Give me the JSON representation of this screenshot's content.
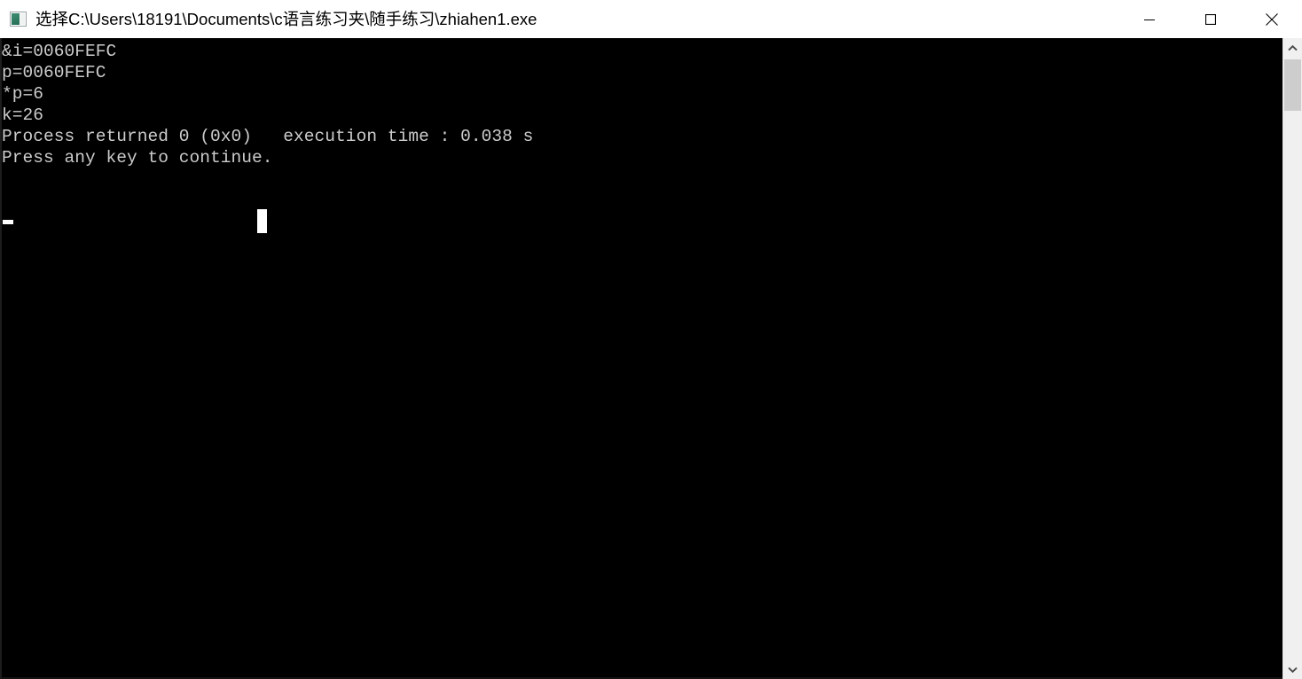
{
  "window": {
    "title": "选择C:\\Users\\18191\\Documents\\c语言练习夹\\随手练习\\zhiahen1.exe",
    "icon_name": "console-app-icon",
    "background_color": "#000000",
    "titlebar_color": "#ffffff"
  },
  "window_controls": {
    "minimize_label": "Minimize",
    "maximize_label": "Maximize",
    "close_label": "Close"
  },
  "console": {
    "foreground_color": "#cccccc",
    "background_color": "#000000",
    "lines": [
      "&i=0060FEFC",
      "p=0060FEFC",
      "*p=6",
      "k=26",
      "Process returned 0 (0x0)   execution time : 0.038 s",
      "Press any key to continue."
    ],
    "text": "&i=0060FEFC\np=0060FEFC\n*p=6\nk=26\nProcess returned 0 (0x0)   execution time : 0.038 s\nPress any key to continue.",
    "cursor_underscore_name": "text-cursor",
    "cursor_block_name": "mouse-block-cursor"
  },
  "scrollbar": {
    "up_arrow_label": "Scroll up",
    "down_arrow_label": "Scroll down",
    "thumb_label": "Scroll thumb",
    "track_color": "#f0f0f0",
    "thumb_color": "#cdcdcd"
  }
}
